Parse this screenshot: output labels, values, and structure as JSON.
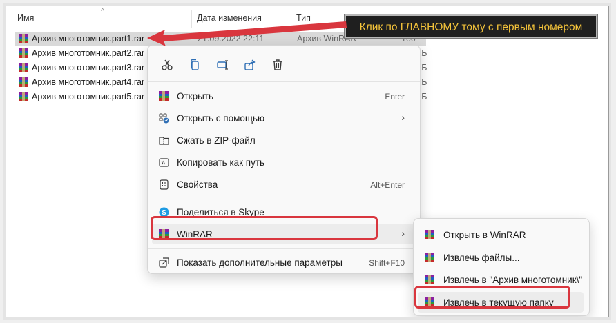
{
  "columns": {
    "name": "Имя",
    "date": "Дата изменения",
    "type": "Тип"
  },
  "files": [
    {
      "name": "Архив многотомник.part1.rar",
      "date": "21.09.2022 22:11",
      "type": "Архив WinRAR",
      "size": "100 КБ"
    },
    {
      "name": "Архив многотомник.part2.rar",
      "size_partial": "КБ"
    },
    {
      "name": "Архив многотомник.part3.rar",
      "size_partial": "КБ"
    },
    {
      "name": "Архив многотомник.part4.rar",
      "size_partial": "КБ"
    },
    {
      "name": "Архив многотомник.part5.rar",
      "size_partial": "КБ"
    }
  ],
  "quick_actions": [
    "cut-icon",
    "copy-icon",
    "rename-icon",
    "share-icon",
    "delete-icon"
  ],
  "context_menu": {
    "items": [
      {
        "label": "Открыть",
        "shortcut": "Enter",
        "icon": "winrar-icon"
      },
      {
        "label": "Открыть с помощью",
        "submenu": true,
        "icon": "open-with-icon"
      },
      {
        "label": "Сжать в ZIP-файл",
        "icon": "zip-icon"
      },
      {
        "label": "Копировать как путь",
        "icon": "copy-path-icon"
      },
      {
        "label": "Свойства",
        "shortcut": "Alt+Enter",
        "icon": "properties-icon"
      },
      {
        "label": "Поделиться в Skype",
        "icon": "skype-icon"
      },
      {
        "label": "WinRAR",
        "submenu": true,
        "icon": "winrar-icon"
      },
      {
        "label": "Показать дополнительные параметры",
        "shortcut": "Shift+F10",
        "icon": "more-options-icon"
      }
    ]
  },
  "winrar_submenu": [
    {
      "label": "Открыть в WinRAR"
    },
    {
      "label": "Извлечь файлы..."
    },
    {
      "label": "Извлечь в \"Архив многотомник\\\""
    },
    {
      "label": "Извлечь в текущую папку"
    }
  ],
  "callout": {
    "text": "Клик по ГЛАВНОМУ тому с первым номером"
  },
  "colors": {
    "highlight": "#d9363e",
    "callout_text": "#f4c33a",
    "callout_bg": "#1f1f1f"
  }
}
